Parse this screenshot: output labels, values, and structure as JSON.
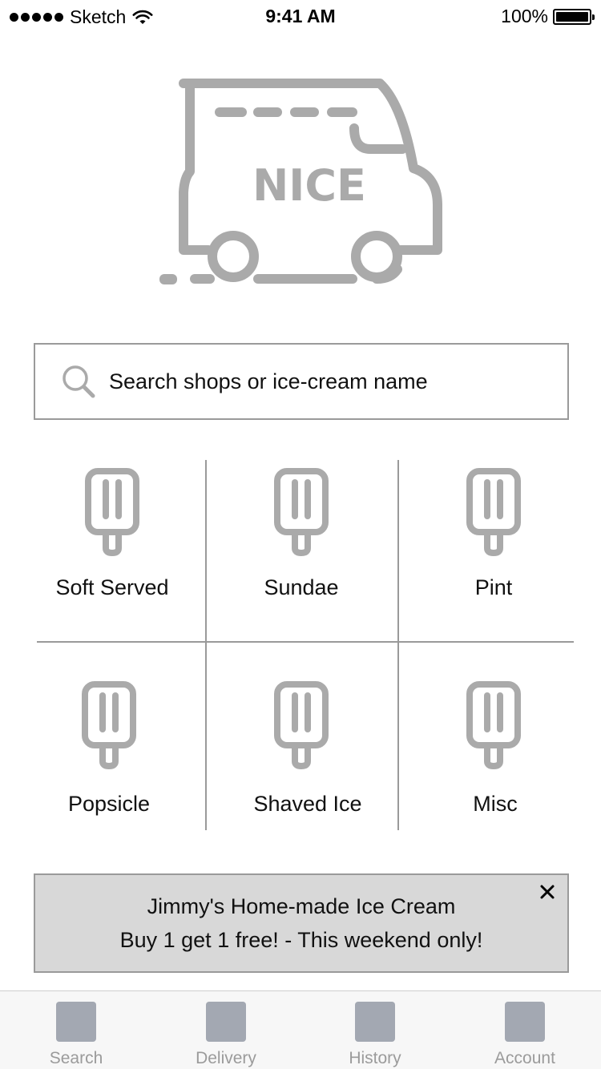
{
  "status_bar": {
    "carrier": "Sketch",
    "time": "9:41 AM",
    "battery": "100%"
  },
  "logo": {
    "text": "NICE"
  },
  "search": {
    "placeholder": "Search shops or ice-cream name"
  },
  "categories": [
    {
      "label": "Soft Served",
      "icon": "popsicle-icon"
    },
    {
      "label": "Sundae",
      "icon": "popsicle-icon"
    },
    {
      "label": "Pint",
      "icon": "popsicle-icon"
    },
    {
      "label": "Popsicle",
      "icon": "popsicle-icon"
    },
    {
      "label": "Shaved Ice",
      "icon": "popsicle-icon"
    },
    {
      "label": "Misc",
      "icon": "popsicle-icon"
    }
  ],
  "promo": {
    "line1": "Jimmy's Home-made Ice Cream",
    "line2": "Buy 1 get 1 free! - This weekend only!",
    "close_icon": "close-icon"
  },
  "tabs": [
    {
      "label": "Search"
    },
    {
      "label": "Delivery"
    },
    {
      "label": "History"
    },
    {
      "label": "Account"
    }
  ],
  "colors": {
    "icon_gray": "#aaaaaa",
    "divider": "#9a9a9a",
    "promo_bg": "#d8d8d8",
    "tab_icon": "#a3a8b2",
    "tab_label": "#9b9b9b"
  }
}
